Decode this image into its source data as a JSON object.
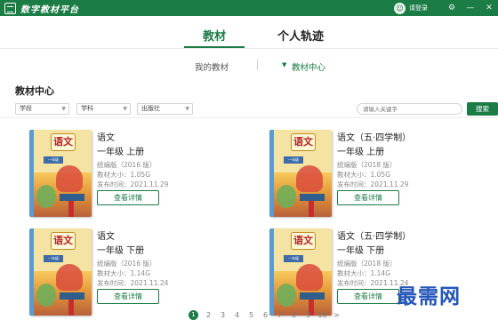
{
  "window": {
    "title": "数字教材平台",
    "login_label": "请登录",
    "avatar_glyph": "☺",
    "controls": [
      "⚙",
      "—",
      "✕"
    ]
  },
  "main_tabs": [
    "教材",
    "个人轨迹"
  ],
  "sub_tabs": {
    "mine": "我的教材",
    "center": "教材中心",
    "center_marker": "▼"
  },
  "section_title": "教材中心",
  "filters": {
    "stage": "学段",
    "subject": "学科",
    "publisher": "出版社"
  },
  "search": {
    "placeholder": "请输入关键字",
    "button_label": "搜索"
  },
  "books": [
    {
      "subject": "语文",
      "grade": "一年级  上册",
      "edition": "统编版（2016 版）",
      "size": "教材大小：1.05G",
      "date": "发布时间：2021.11.29",
      "cover_title": "语文",
      "cover_tag": "一年级",
      "button": "查看详情"
    },
    {
      "subject": "语文（五·四学制）",
      "grade": "一年级  上册",
      "edition": "统编版（2018 版）",
      "size": "教材大小：1.05G",
      "date": "发布时间：2021.11.29",
      "cover_title": "语文",
      "cover_tag": "一年级",
      "button": "查看详情"
    },
    {
      "subject": "语文",
      "grade": "一年级  下册",
      "edition": "统编版（2016 版）",
      "size": "教材大小：1.14G",
      "date": "发布时间：2021.11.24",
      "cover_title": "语文",
      "cover_tag": "一年级",
      "button": "查看详情"
    },
    {
      "subject": "语文（五·四学制）",
      "grade": "一年级  下册",
      "edition": "统编版（2018 版）",
      "size": "教材大小：1.14G",
      "date": "发布时间：2021.11.24",
      "cover_title": "语文",
      "cover_tag": "一年级",
      "button": "查看详情"
    }
  ],
  "pagination": {
    "pages": [
      "1",
      "2",
      "3",
      "4",
      "5",
      "6",
      "7",
      "8",
      "9",
      "10"
    ],
    "current": "1",
    "next": ">"
  },
  "watermark": "最需网",
  "colors": {
    "brand": "#1b7c46",
    "watermark": "#2456b8"
  }
}
